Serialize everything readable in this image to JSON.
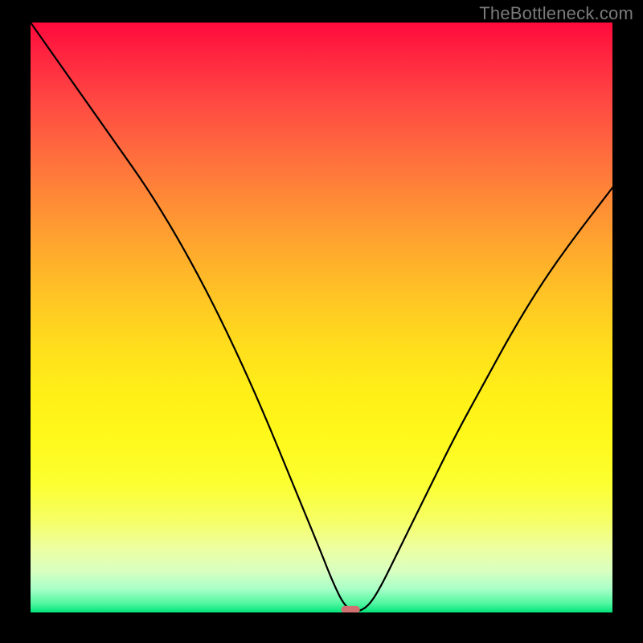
{
  "watermark": "TheBottleneck.com",
  "colors": {
    "frame_background": "#000000",
    "curve_stroke": "#000000",
    "marker_fill": "#d07070",
    "gradient_top": "#ff0a3c",
    "gradient_bottom": "#00e47a",
    "watermark_text": "#7a7a7a"
  },
  "chart_data": {
    "type": "line",
    "title": "",
    "xlabel": "",
    "ylabel": "",
    "xlim": [
      0,
      100
    ],
    "ylim": [
      0,
      100
    ],
    "grid": false,
    "legend": false,
    "series": [
      {
        "name": "bottleneck-curve",
        "x": [
          0,
          5,
          10,
          15,
          20,
          25,
          30,
          35,
          40,
          45,
          50,
          52,
          54,
          56,
          58,
          60,
          63,
          68,
          73,
          78,
          83,
          88,
          93,
          100
        ],
        "y": [
          100,
          93,
          86,
          79,
          72,
          64,
          55,
          45,
          34,
          22,
          10,
          5,
          1,
          0,
          1,
          4,
          10,
          20,
          30,
          39,
          48,
          56,
          63,
          72
        ]
      }
    ],
    "marker": {
      "name": "optimal-point",
      "x": 55.0,
      "y": 0.5,
      "width_pct": 3.2,
      "height_pct": 1.2
    },
    "description": "V-shaped bottleneck curve over vertical red→green gradient; minimum near x≈55 at y≈0 (green band). Left branch starts at top-left (100%) and drops steeply; right branch rises to ~72% at right edge."
  }
}
